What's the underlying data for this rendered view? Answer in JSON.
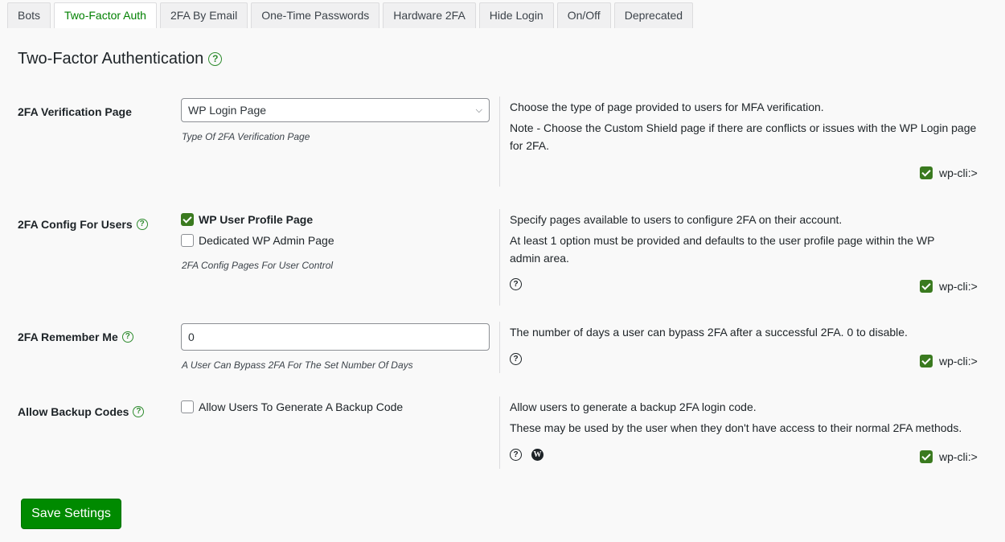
{
  "tabs": [
    "Bots",
    "Two-Factor Auth",
    "2FA By Email",
    "One-Time Passwords",
    "Hardware 2FA",
    "Hide Login",
    "On/Off",
    "Deprecated"
  ],
  "page_title": "Two-Factor Authentication",
  "help_glyph": "?",
  "wp_glyph": "W",
  "wpcli_label": "wp-cli:>",
  "section_verification": {
    "label": "2FA Verification Page",
    "select_value": "WP Login Page",
    "hint": "Type Of 2FA Verification Page",
    "desc1": "Choose the type of page provided to users for MFA verification.",
    "desc2": "Note - Choose the Custom Shield page if there are conflicts or issues with the WP Login page for 2FA."
  },
  "section_config": {
    "label": "2FA Config For Users",
    "option1": "WP User Profile Page",
    "option1_checked": true,
    "option2": "Dedicated WP Admin Page",
    "option2_checked": false,
    "hint": "2FA Config Pages For User Control",
    "desc1": "Specify pages available to users to configure 2FA on their account.",
    "desc2": "At least 1 option must be provided and defaults to the user profile page within the WP admin area."
  },
  "section_remember": {
    "label": "2FA Remember Me",
    "input_value": "0",
    "hint": "A User Can Bypass 2FA For The Set Number Of Days",
    "desc1": "The number of days a user can bypass 2FA after a successful 2FA. 0 to disable."
  },
  "section_backup": {
    "label": "Allow Backup Codes",
    "option": "Allow Users To Generate A Backup Code",
    "option_checked": false,
    "desc1": "Allow users to generate a backup 2FA login code.",
    "desc2": "These may be used by the user when they don't have access to their normal 2FA methods."
  },
  "save_label": "Save Settings",
  "colors": {
    "accent": "#008000",
    "button": "#008a00",
    "checkbox": "#3a7a1f"
  }
}
